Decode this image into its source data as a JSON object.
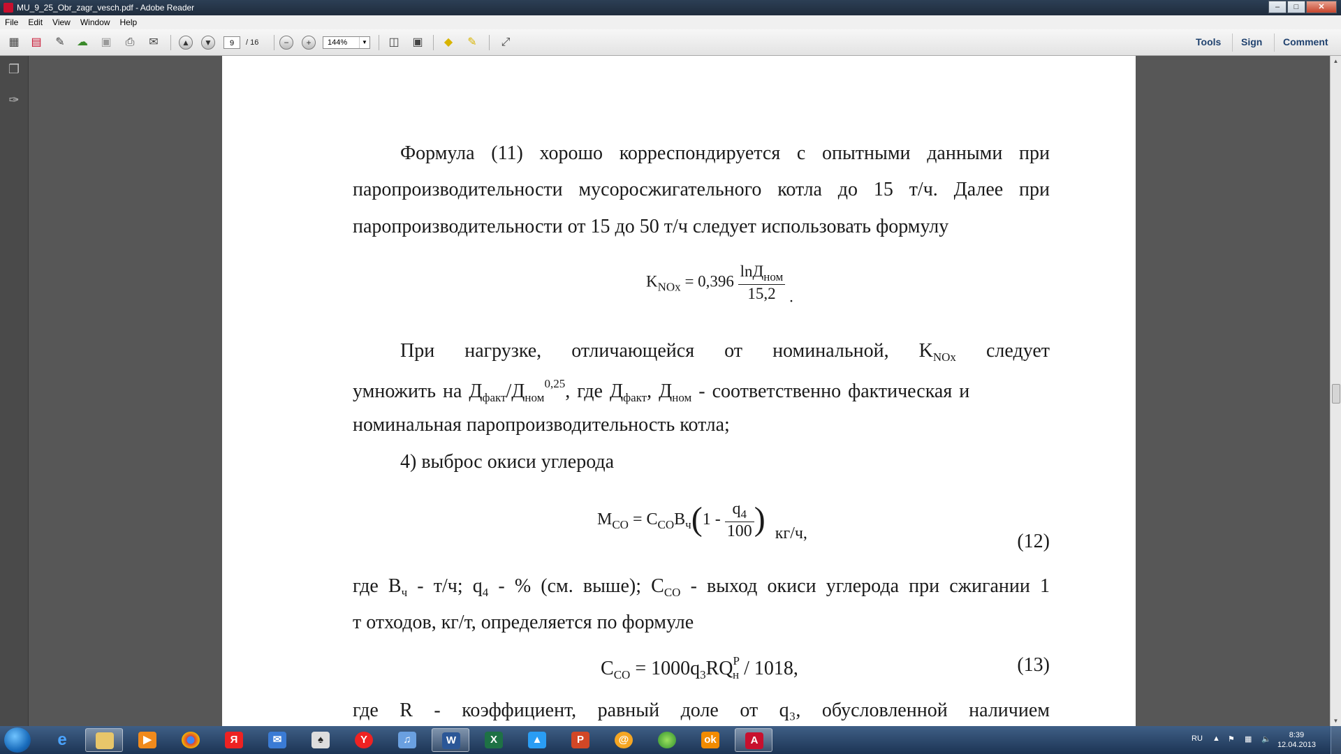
{
  "window": {
    "title": "MU_9_25_Obr_zagr_vesch.pdf - Adobe Reader",
    "min": "–",
    "max": "□",
    "close": "✕"
  },
  "menu": [
    "File",
    "Edit",
    "View",
    "Window",
    "Help"
  ],
  "toolbar": {
    "page_current": "9",
    "page_total": "/ 16",
    "zoom": "144%",
    "tools": "Tools",
    "sign": "Sign",
    "comment": "Comment"
  },
  "document": {
    "p1": [
      "Формула (11) хорошо корреспондируется с опытными данными при",
      "паропроизводительности мусоросжигательного котла до 15 т/ч. Далее при",
      "паропроизводительности от 15 до 50 т/ч следует использовать формулу"
    ],
    "f1": {
      "lhs": "K",
      "lhs_sub": "NOx",
      "eq": " = 0,396",
      "num": "lnД",
      "num_sub": "ном",
      "den": "15,2",
      "end": "."
    },
    "p2": {
      "l1_a": "При нагрузке, отличающейся от номинальной, K",
      "l1_sub": "NOx",
      "l1_b": " следует",
      "l2_a": "умножить на Д",
      "l2_s1": "факт",
      "l2_b": "/Д",
      "l2_s2": "ном",
      "l2_sup": "0,25",
      "l2_c": ", где Д",
      "l2_s3": "факт",
      "l2_d": ", Д",
      "l2_s4": "ном",
      "l2_e": " - соответственно фактическая и",
      "l3": "номинальная паропроизводительность котла;"
    },
    "item4": "4) выброс окиси углерода",
    "f2": {
      "m": "M",
      "m_sub": "CO",
      "eq": " = C",
      "c_sub": "CO",
      "b": "B",
      "b_sub": "ч",
      "paren_l": "(",
      "one": "1 - ",
      "num": "q",
      "num_sub": "4",
      "den": "100",
      "paren_r": ")",
      "unit": "кг/ч,",
      "tag": "(12)"
    },
    "p3": {
      "l1_a": "где B",
      "l1_s1": "ч",
      "l1_b": " - т/ч; q",
      "l1_s2": "4",
      "l1_c": " - % (см. выше); C",
      "l1_s3": "CO",
      "l1_d": " - выход окиси углерода при сжигании 1",
      "l2": "т отходов, кг/т, определяется по формуле"
    },
    "f3": {
      "a": "C",
      "a_sub": "CO",
      "b": " = 1000q",
      "b_sub": "3",
      "c": "RQ",
      "sup": "P",
      "c_sub": "н",
      "d": " / 1018,",
      "tag": "(13)"
    },
    "p4": "где R - коэффициент, равный доле от q₃, обусловленной наличием"
  },
  "taskbar": {
    "lang": "RU",
    "time": "8:39",
    "date": "12.04.2013"
  }
}
